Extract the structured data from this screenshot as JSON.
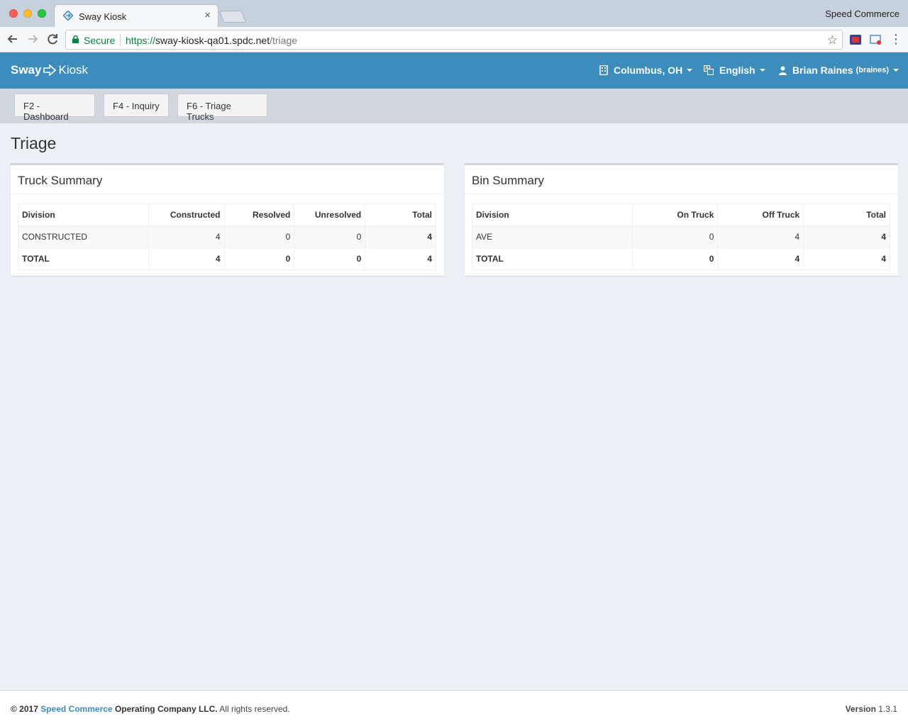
{
  "browser": {
    "tab_title": "Sway Kiosk",
    "tab_close": "×",
    "profile_name": "Speed Commerce",
    "secure_label": "Secure",
    "url_scheme": "https://",
    "url_host": "sway-kiosk-qa01.spdc.net",
    "url_path": "/triage"
  },
  "header": {
    "brand_sway": "Sway",
    "brand_kiosk": "Kiosk",
    "location": "Columbus, OH",
    "language": "English",
    "user_name": "Brian Raines",
    "user_login": "(braines)",
    "brand_color": "#3c8dbc"
  },
  "fkeys": {
    "dashboard": "F2 - Dashboard",
    "inquiry": "F4 - Inquiry",
    "triage_trucks": "F6 - Triage Trucks"
  },
  "page": {
    "title": "Triage"
  },
  "truck_summary": {
    "title": "Truck Summary",
    "columns": [
      "Division",
      "Constructed",
      "Resolved",
      "Unresolved",
      "Total"
    ],
    "rows": [
      [
        "CONSTRUCTED",
        "4",
        "0",
        "0",
        "4"
      ]
    ],
    "total_row": [
      "TOTAL",
      "4",
      "0",
      "0",
      "4"
    ]
  },
  "bin_summary": {
    "title": "Bin Summary",
    "columns": [
      "Division",
      "On Truck",
      "Off Truck",
      "Total"
    ],
    "rows": [
      [
        "AVE",
        "0",
        "4",
        "4"
      ]
    ],
    "total_row": [
      "TOTAL",
      "0",
      "4",
      "4"
    ]
  },
  "footer": {
    "copyright": "© 2017",
    "company_link": "Speed Commerce",
    "company_rest": "Operating Company LLC.",
    "rights": "All rights reserved.",
    "version_label": "Version",
    "version_value": "1.3.1"
  }
}
